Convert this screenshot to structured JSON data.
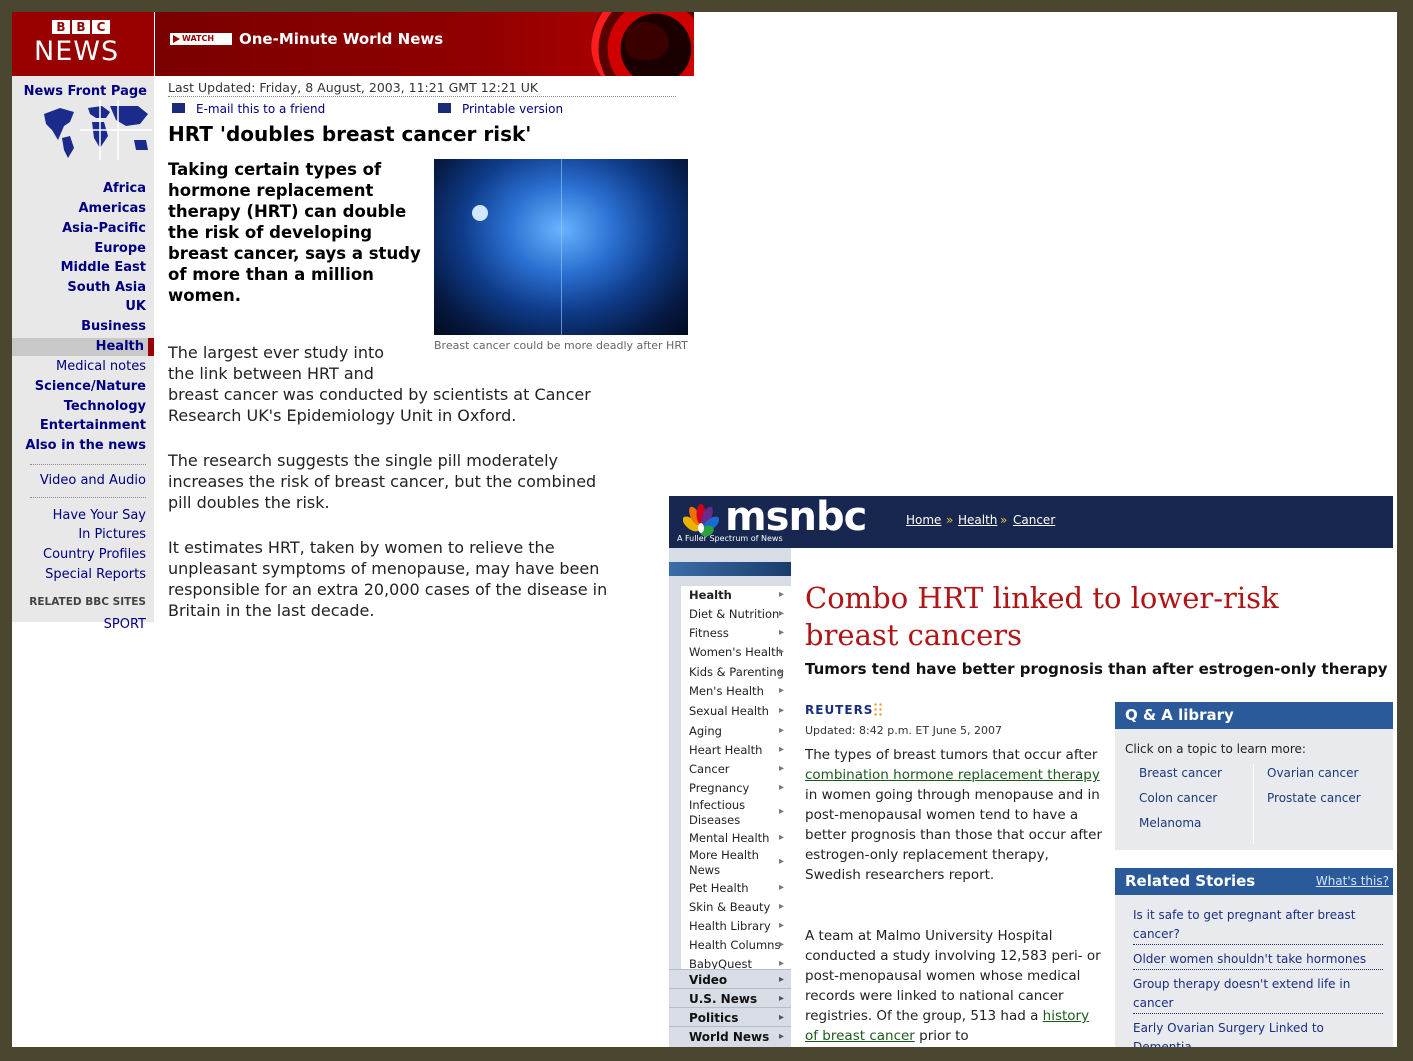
{
  "bbc": {
    "logo_letters": [
      "B",
      "B",
      "C"
    ],
    "logo_word": "NEWS",
    "banner": {
      "watch_label": "WATCH",
      "title": "One-Minute World News"
    },
    "sidebar": {
      "front_page": "News Front Page",
      "regions": [
        "Africa",
        "Americas",
        "Asia-Pacific",
        "Europe",
        "Middle East",
        "South Asia",
        "UK"
      ],
      "business": "Business",
      "health": "Health",
      "medical_notes": "Medical notes",
      "sections": [
        "Science/Nature",
        "Technology",
        "Entertainment",
        "Also in the news"
      ],
      "video_audio": "Video and Audio",
      "more": [
        "Have Your Say",
        "In Pictures",
        "Country Profiles",
        "Special Reports"
      ],
      "related_heading": "RELATED BBC SITES",
      "sport": "SPORT"
    },
    "article": {
      "last_updated_label": "Last Updated:",
      "last_updated_value": "Friday, 8 August, 2003, 11:21 GMT 12:21 UK",
      "email_link": "E-mail this to a friend",
      "print_link": "Printable version",
      "headline": "HRT 'doubles breast cancer risk'",
      "intro": "Taking certain types of hormone replacement therapy (HRT) can double the risk of developing breast cancer, says a study of more than a million women.",
      "caption": "Breast cancer could be more deadly after HRT",
      "para1_short_a": "The largest ever study into",
      "para1_short_b": "the link between HRT and",
      "para1_rest_a": "breast cancer was conducted by scientists at Cancer",
      "para1_rest_b": "Research UK's Epidemiology Unit in Oxford.",
      "para2_a": "The research suggests the single pill moderately",
      "para2_b": "increases the risk of breast cancer, but the combined",
      "para2_c": "pill doubles the risk.",
      "para3_a": "It estimates HRT, taken by women to relieve the",
      "para3_b": "unpleasant symptoms of menopause, may have been",
      "para3_c": "responsible for an extra 20,000 cases of the disease in",
      "para3_d": "Britain in the last decade."
    }
  },
  "msnbc": {
    "logo_word": "msnbc",
    "tagline": "A Fuller Spectrum of News",
    "breadcrumb": [
      "Home",
      "Health",
      "Cancer"
    ],
    "breadcrumb_sep": "»",
    "nav": [
      "Health",
      "Diet & Nutrition",
      "Fitness",
      "Women's Health",
      "Kids & Parenting",
      "Men's Health",
      "Sexual Health",
      "Aging",
      "Heart Health",
      "Cancer",
      "Pregnancy",
      "Infectious",
      "Diseases",
      "Mental Health",
      "More Health",
      "News",
      "Pet Health",
      "Skin & Beauty",
      "Health Library",
      "Health Columns",
      "BabyQuest"
    ],
    "main_nav": [
      "Video",
      "U.S. News",
      "Politics",
      "World News"
    ],
    "headline": "Combo HRT linked to lower-risk breast cancers",
    "subhead": "Tumors tend have better prognosis than after estrogen-only therapy",
    "source": "REUTERS",
    "updated": "Updated: 8:42 p.m. ET June 5, 2007",
    "body1_pre": "The types of breast tumors that occur after ",
    "body1_link": "combination hormone replacement therapy",
    "body1_post": " in women going through menopause and in post-menopausal women tend to have a better prognosis than those that occur after estrogen-only replacement therapy, Swedish researchers report.",
    "body2_pre": "A team at Malmo University Hospital conducted a study involving 12,583 peri- or post-menopausal women whose medical records were linked to national cancer registries. Of the group, 513 had a ",
    "body2_link": "history of breast cancer",
    "body2_post": " prior to",
    "qa": {
      "title": "Q & A library",
      "intro": "Click on a topic to learn more:",
      "links": [
        "Breast cancer",
        "Ovarian cancer",
        "Colon cancer",
        "Prostate cancer",
        "Melanoma"
      ]
    },
    "related": {
      "title": "Related Stories",
      "whats_this": "What's this?",
      "links": [
        "Is it safe to get pregnant after breast cancer?",
        "Older women shouldn't take hormones",
        "Group therapy doesn't extend life in cancer",
        "Early Ovarian Surgery Linked to Dementia"
      ]
    },
    "colors": {
      "header": "#17274f",
      "headline": "#b01414",
      "box_title": "#2a5a99"
    }
  },
  "colors": {
    "bbc_red": "#990000",
    "bbc_link": "#000080",
    "frame": "#4a4630"
  }
}
